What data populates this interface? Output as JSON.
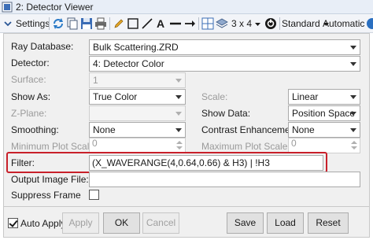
{
  "window": {
    "title": "2: Detector Viewer"
  },
  "toolbar": {
    "settings_label": "Settings",
    "layout_label": "3 x 4",
    "standard_label": "Standard",
    "automatic_label": "Automatic"
  },
  "form": {
    "ray_database": {
      "label": "Ray Database:",
      "value": "Bulk Scattering.ZRD"
    },
    "detector": {
      "label": "Detector:",
      "value": "4: Detector Color"
    },
    "surface": {
      "label": "Surface:",
      "value": "1"
    },
    "show_as": {
      "label": "Show As:",
      "value": "True Color"
    },
    "scale": {
      "label": "Scale:",
      "value": "Linear"
    },
    "z_plane": {
      "label": "Z-Plane:"
    },
    "show_data": {
      "label": "Show Data:",
      "value": "Position Space"
    },
    "smoothing": {
      "label": "Smoothing:",
      "value": "None"
    },
    "contrast": {
      "label": "Contrast Enhancement:",
      "value": "None"
    },
    "min_plot_scale": {
      "label": "Minimum Plot Scale:",
      "value": "0"
    },
    "max_plot_scale": {
      "label": "Maximum Plot Scale:",
      "value": "0"
    },
    "filter": {
      "label": "Filter:",
      "value": "(X_WAVERANGE(4,0.64,0.66) & H3) | !H3"
    },
    "output_image_file": {
      "label": "Output Image File:",
      "value": ""
    },
    "suppress_frame": {
      "label": "Suppress Frame",
      "checked": false
    }
  },
  "footer": {
    "auto_apply": {
      "label": "Auto Apply",
      "checked": true
    },
    "apply": "Apply",
    "ok": "OK",
    "cancel": "Cancel",
    "save": "Save",
    "load": "Load",
    "reset": "Reset"
  }
}
